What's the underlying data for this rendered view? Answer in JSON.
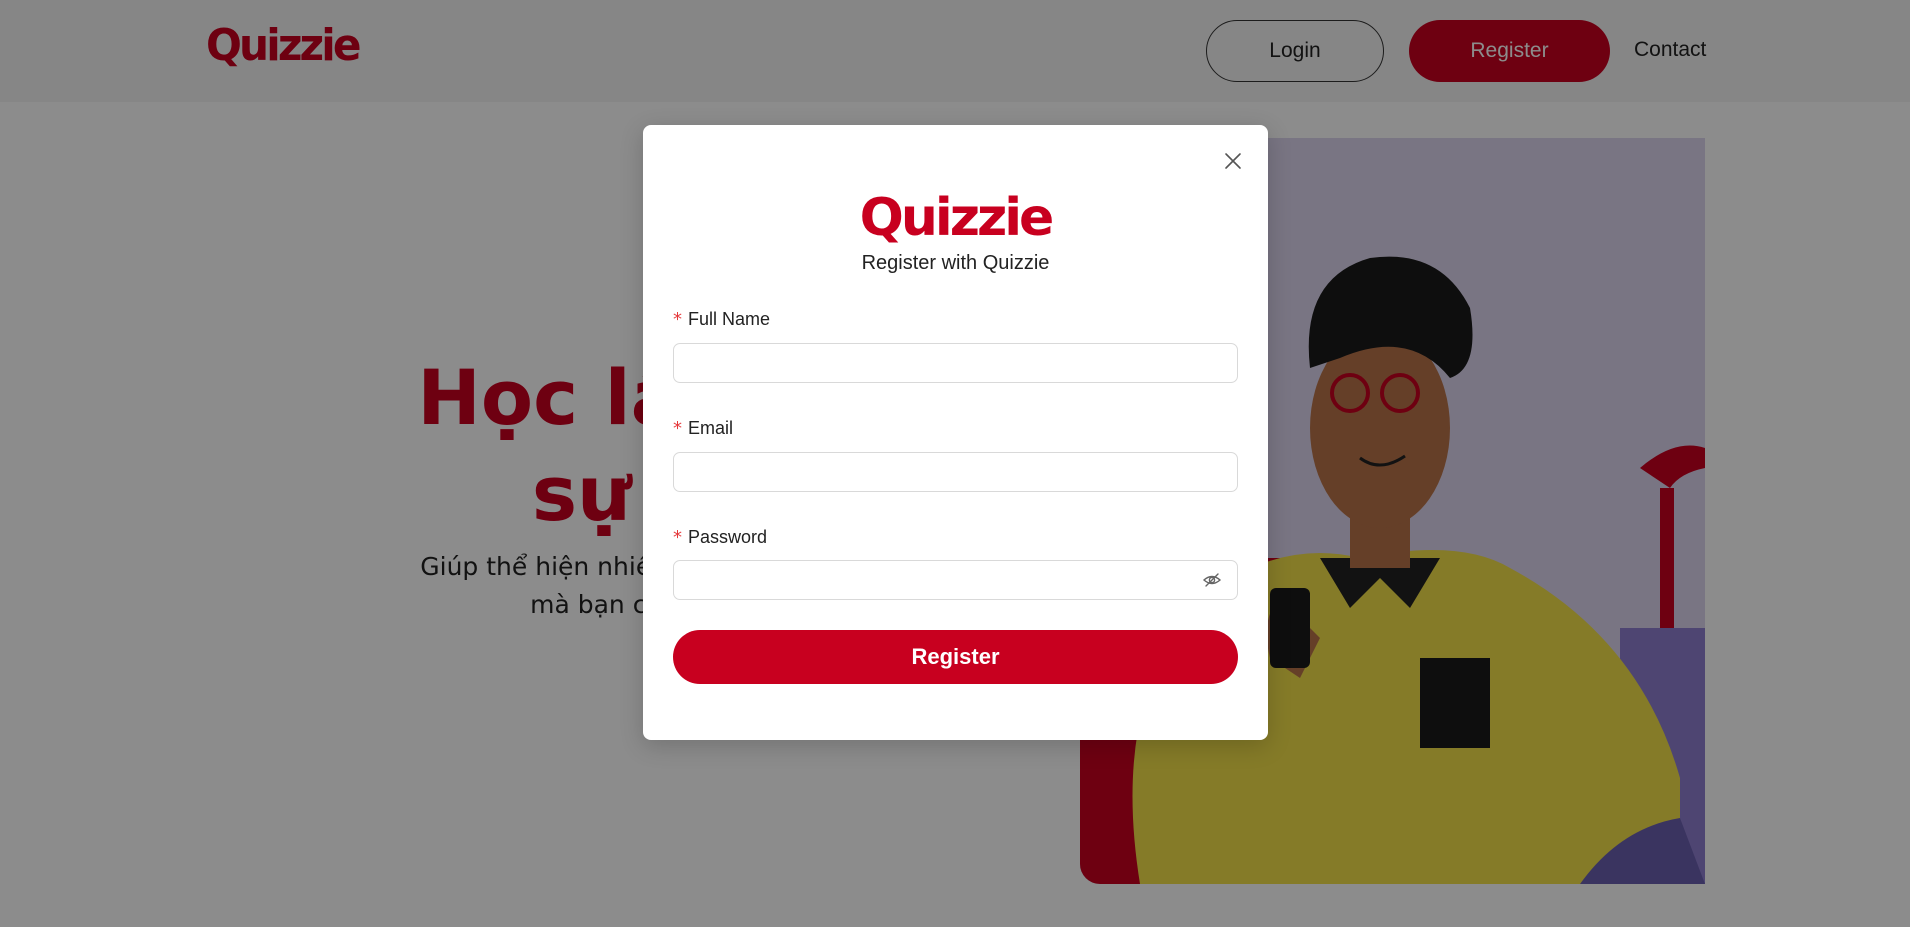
{
  "header": {
    "logo": "Quizzie",
    "login_label": "Login",
    "register_label": "Register",
    "contact_label": "Contact"
  },
  "hero": {
    "title_line1": "Học lập trì",
    "title_line2": "sự tự",
    "subtitle_line1": "Giúp thể hiện nhiều hơn kĩ năng củ",
    "subtitle_line2": "mà bạn cảm thấy"
  },
  "modal": {
    "logo": "Quizzie",
    "subtitle": "Register with Quizzie",
    "required_mark": "*",
    "fields": {
      "full_name_label": "Full Name",
      "full_name_value": "",
      "email_label": "Email",
      "email_value": "",
      "password_label": "Password",
      "password_value": ""
    },
    "submit_label": "Register"
  },
  "icons": {
    "close": "close-icon",
    "password_toggle": "eye-off-icon"
  },
  "colors": {
    "brand": "#c8001f",
    "required": "#e5383b",
    "overlay": "rgba(0,0,0,0.45)"
  }
}
